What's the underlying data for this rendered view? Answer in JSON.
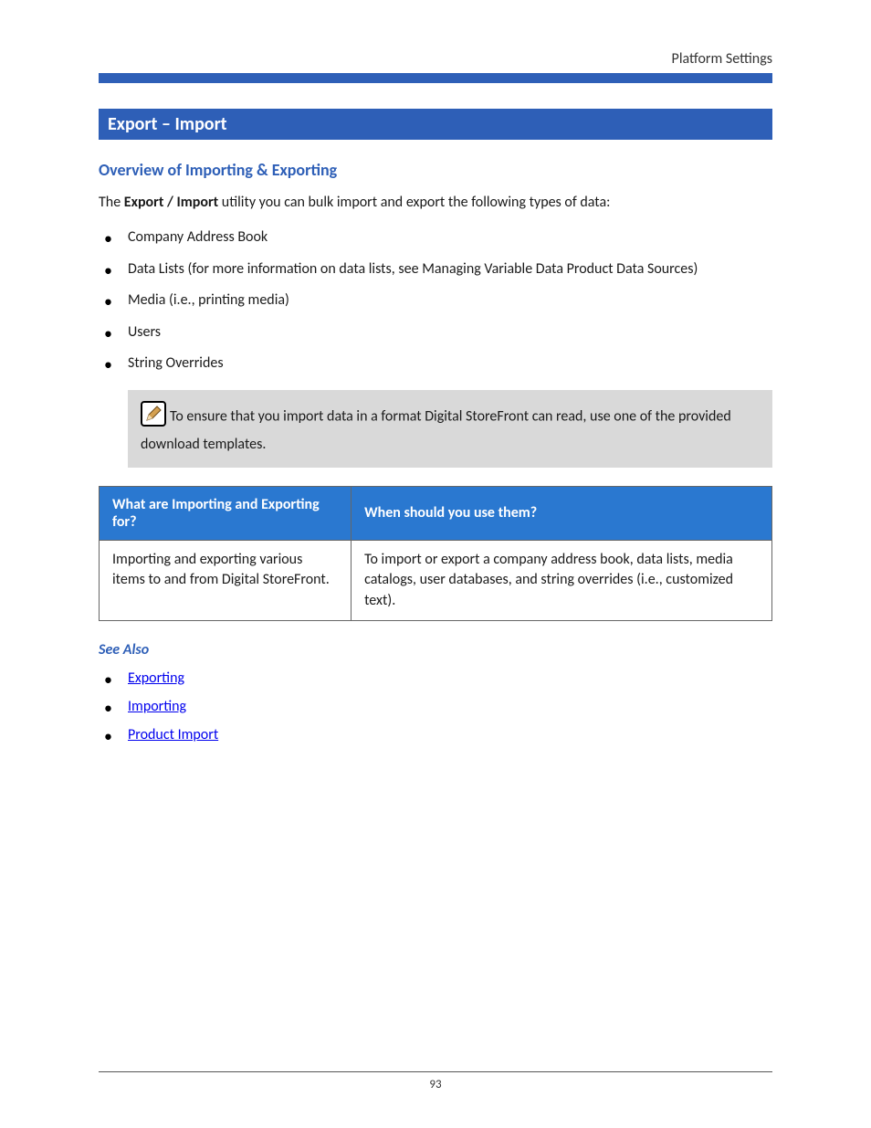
{
  "header": {
    "label": "Platform Settings"
  },
  "section": {
    "title": "Export – Import"
  },
  "subsection": {
    "title": "Overview of Importing & Exporting"
  },
  "intro": {
    "prefix": "The ",
    "bold": "Export / Import",
    "suffix": " utility you can bulk import and export the following types of data:"
  },
  "bullets": {
    "item1": "Company Address Book",
    "item2": "Data Lists (for more information on data lists, see Managing Variable Data Product Data Sources)",
    "item3": "Media (i.e., printing media)",
    "item4": "Users",
    "item5": "String Overrides"
  },
  "note": {
    "text": "To ensure that you import data in a format Digital StoreFront can read, use one of the provided download templates."
  },
  "table": {
    "header1": "What are Importing and Exporting for?",
    "header2": "When should you use them?",
    "cell1": "Importing and exporting various items to and from Digital StoreFront.",
    "cell2": "To import or export a company address book, data lists, media catalogs, user databases, and string overrides (i.e., customized text)."
  },
  "seeAlso": {
    "title": "See Also",
    "link1": "Exporting",
    "link2": "Importing",
    "link3": "Product Import"
  },
  "footer": {
    "pageNumber": "93"
  }
}
